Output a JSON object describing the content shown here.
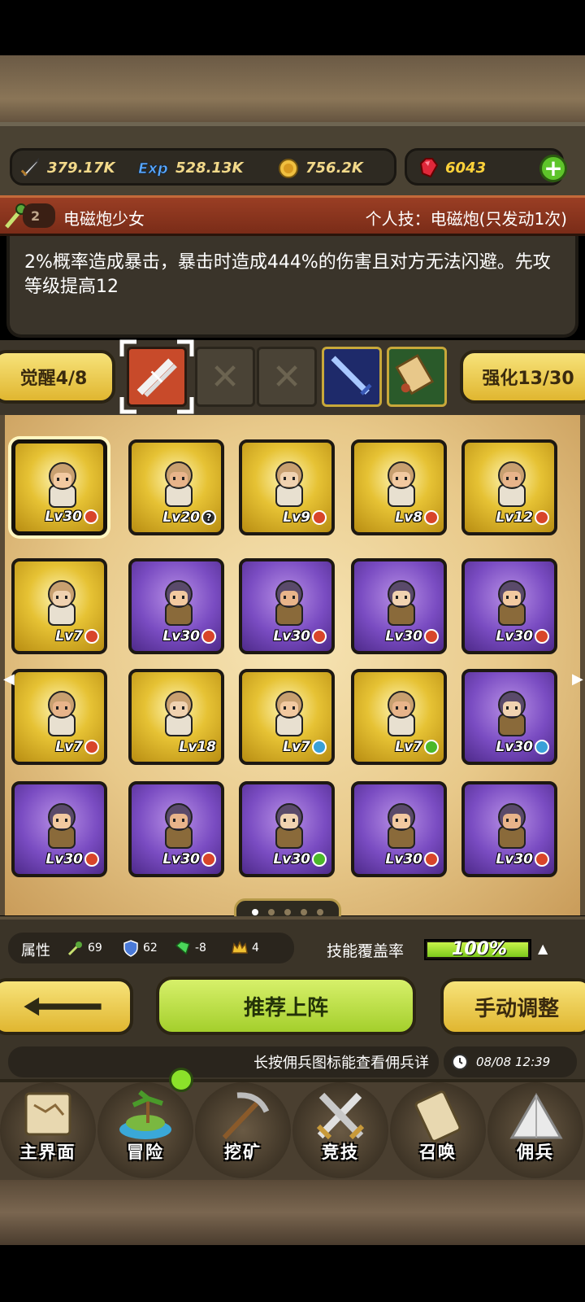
{
  "resources": {
    "attack": "379.17K",
    "exp": "528.13K",
    "gold": "756.2K",
    "gems": "6043"
  },
  "skill": {
    "level": "2",
    "name": "电磁炮少女",
    "tag": "个人技：电磁炮(只发动1次)",
    "description": "2%概率造成暴击，暴击时造成444%的伤害且对方无法闪避。先攻等级提高12"
  },
  "awaken": {
    "label": "觉醒4/8"
  },
  "enhance": {
    "label": "强化13/30"
  },
  "roster": [
    {
      "level": "Lv30",
      "badge": "red",
      "frame": "gold",
      "selected": true,
      "avatar": "hero-girl-brown-hair"
    },
    {
      "level": "Lv20",
      "badge": "help",
      "frame": "gold",
      "avatar": "hero-eagle-totem"
    },
    {
      "level": "Lv9",
      "badge": "red",
      "frame": "gold",
      "avatar": "hero-blonde-priestess"
    },
    {
      "level": "Lv8",
      "badge": "red",
      "frame": "gold",
      "avatar": "hero-white-hair-elder"
    },
    {
      "level": "Lv12",
      "badge": "red",
      "frame": "gold",
      "avatar": "hero-white-hair-elder"
    },
    {
      "level": "Lv7",
      "badge": "red",
      "frame": "gold",
      "avatar": "hero-white-hair-elder"
    },
    {
      "level": "Lv30",
      "badge": "red",
      "frame": "purple",
      "avatar": "hero-bearded-sage"
    },
    {
      "level": "Lv30",
      "badge": "red",
      "frame": "purple",
      "avatar": "hero-dark-queen"
    },
    {
      "level": "Lv30",
      "badge": "red",
      "frame": "purple",
      "avatar": "hero-bandana-warrior"
    },
    {
      "level": "Lv30",
      "badge": "red",
      "frame": "purple",
      "avatar": "hero-blue-hair-knight"
    },
    {
      "level": "Lv7",
      "badge": "red",
      "frame": "gold",
      "avatar": "hero-maid"
    },
    {
      "level": "Lv18",
      "badge": "",
      "frame": "gold",
      "avatar": "hero-orange-hair-boy"
    },
    {
      "level": "Lv7",
      "badge": "blue",
      "frame": "gold",
      "avatar": "hero-bald-man"
    },
    {
      "level": "Lv7",
      "badge": "green",
      "frame": "gold",
      "avatar": "hero-gold-dragon"
    },
    {
      "level": "Lv30",
      "badge": "blue",
      "frame": "purple",
      "avatar": "hero-floral-girl"
    },
    {
      "level": "Lv30",
      "badge": "red",
      "frame": "purple",
      "avatar": "hero-green-general"
    },
    {
      "level": "Lv30",
      "badge": "red",
      "frame": "purple",
      "avatar": "hero-green-general"
    },
    {
      "level": "Lv30",
      "badge": "green",
      "frame": "purple",
      "avatar": "hero-silver-knight"
    },
    {
      "level": "Lv30",
      "badge": "red",
      "frame": "purple",
      "avatar": "hero-fire-monk"
    },
    {
      "level": "Lv30",
      "badge": "red",
      "frame": "purple",
      "avatar": "hero-starfish"
    }
  ],
  "stats": {
    "attribute_label": "属性",
    "nature": "69",
    "defense": "62",
    "gem": "-8",
    "crown": "4",
    "coverage_label": "技能覆盖率",
    "coverage_value": "100%",
    "coverage_fraction": 1.0
  },
  "actions": {
    "recommend": "推荐上阵",
    "manual": "手动调整"
  },
  "ticker": {
    "message": "长按佣兵图标能查看佣兵详",
    "time": "08/08 12:39"
  },
  "nav": [
    {
      "label": "主界面",
      "icon": "map-scroll-icon"
    },
    {
      "label": "冒险",
      "icon": "island-icon"
    },
    {
      "label": "挖矿",
      "icon": "pickaxe-icon"
    },
    {
      "label": "竞技",
      "icon": "crossed-swords-icon"
    },
    {
      "label": "召唤",
      "icon": "summon-scroll-icon"
    },
    {
      "label": "佣兵",
      "icon": "tent-icon"
    }
  ],
  "colors": {
    "gold_frame": "#e6c234",
    "purple_frame": "#7a4cc2",
    "accent_green": "#a4cf2c",
    "skill_red": "#9a3e24"
  }
}
